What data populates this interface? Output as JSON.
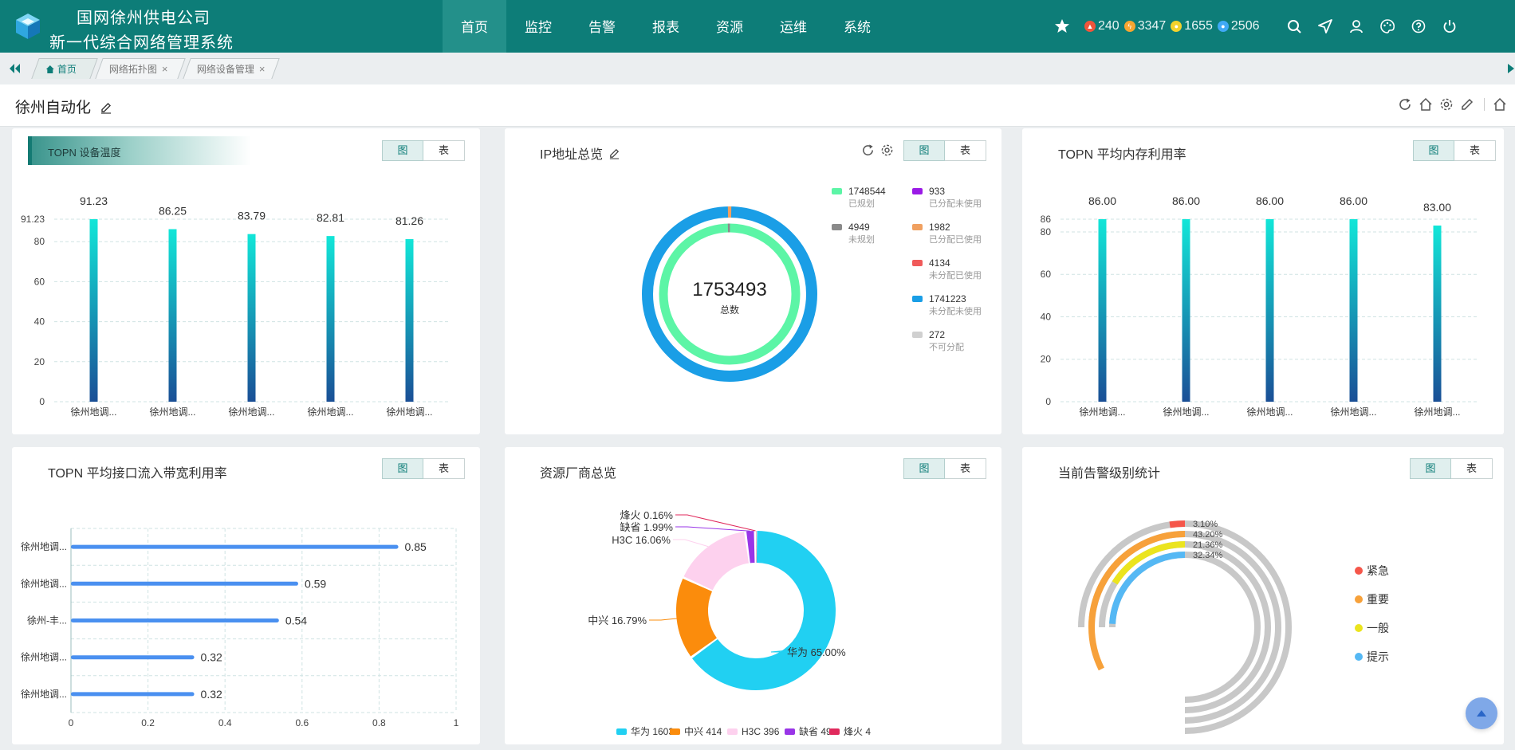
{
  "header": {
    "company": "国网徐州供电公司",
    "system": "新一代综合网络管理系统",
    "nav": [
      "首页",
      "监控",
      "告警",
      "报表",
      "资源",
      "运维",
      "系统"
    ],
    "stats": [
      {
        "icon": "fire-icon",
        "value": "240",
        "color": "#f0553b"
      },
      {
        "icon": "bolt-icon",
        "value": "3347",
        "color": "#f7a531"
      },
      {
        "icon": "sun-icon",
        "value": "1655",
        "color": "#f2d22c"
      },
      {
        "icon": "drop-icon",
        "value": "2506",
        "color": "#3fa9f5"
      }
    ]
  },
  "tabs": [
    {
      "label": "首页"
    },
    {
      "label": "网络拓扑图"
    },
    {
      "label": "网络设备管理"
    }
  ],
  "page": {
    "title": "徐州自动化"
  },
  "toggle": {
    "chart": "图",
    "table": "表"
  },
  "colors": {
    "brand": "#0d7d78",
    "accent": "#23908a"
  },
  "panels": {
    "temp": {
      "title": "TOPN 设备温度"
    },
    "ip": {
      "title": "IP地址总览"
    },
    "mem": {
      "title": "TOPN 平均内存利用率"
    },
    "bw": {
      "title": "TOPN 平均接口流入带宽利用率"
    },
    "vendor": {
      "title": "资源厂商总览"
    },
    "alarm": {
      "title": "当前告警级别统计"
    }
  },
  "chart_data": [
    {
      "id": "temp",
      "type": "bar",
      "categories": [
        "徐州地调...",
        "徐州地调...",
        "徐州地调...",
        "徐州地调...",
        "徐州地调..."
      ],
      "values": [
        91.23,
        86.25,
        83.79,
        82.81,
        81.26
      ],
      "labels": [
        "91.23",
        "86.25",
        "83.79",
        "82.81",
        "81.26"
      ],
      "yticks": [
        "0",
        "20",
        "40",
        "60",
        "80",
        "91.23"
      ],
      "ylim": [
        0,
        91.23
      ]
    },
    {
      "id": "ip",
      "type": "pie",
      "total": "1753493",
      "total_label": "总数",
      "legend": [
        {
          "value": "1748544",
          "name": "已规划",
          "color": "#5cf5a6"
        },
        {
          "value": "933",
          "name": "已分配未使用",
          "color": "#9a1ae6"
        },
        {
          "value": "4949",
          "name": "未规划",
          "color": "#8a8a8a"
        },
        {
          "value": "1982",
          "name": "已分配已使用",
          "color": "#f0a060"
        },
        {
          "value": "4134",
          "name": "未分配已使用",
          "color": "#f05a5a"
        },
        {
          "value": "1741223",
          "name": "未分配未使用",
          "color": "#1a9ee6"
        },
        {
          "value": "272",
          "name": "不可分配",
          "color": "#d0d0d0"
        }
      ]
    },
    {
      "id": "mem",
      "type": "bar",
      "categories": [
        "徐州地调...",
        "徐州地调...",
        "徐州地调...",
        "徐州地调...",
        "徐州地调..."
      ],
      "values": [
        86,
        86,
        86,
        86,
        83
      ],
      "labels": [
        "86.00",
        "86.00",
        "86.00",
        "86.00",
        "83.00"
      ],
      "yticks": [
        "0",
        "20",
        "40",
        "60",
        "80",
        "86"
      ],
      "ylim": [
        0,
        86
      ]
    },
    {
      "id": "bw",
      "type": "bar",
      "orientation": "horizontal",
      "categories": [
        "徐州地调...",
        "徐州地调...",
        "徐州-丰...",
        "徐州地调...",
        "徐州地调..."
      ],
      "values": [
        0.85,
        0.59,
        0.54,
        0.32,
        0.32
      ],
      "labels": [
        "0.85",
        "0.59",
        "0.54",
        "0.32",
        "0.32"
      ],
      "xticks": [
        "0",
        "0.2",
        "0.4",
        "0.6",
        "0.8",
        "1"
      ],
      "xlim": [
        0,
        1
      ]
    },
    {
      "id": "vendor",
      "type": "pie",
      "slices": [
        {
          "name": "华为",
          "value": 1603,
          "label": "华为 65.00%",
          "color": "#21d0f2"
        },
        {
          "name": "中兴",
          "value": 414,
          "label": "中兴 16.79%",
          "color": "#fb8c0c"
        },
        {
          "name": "H3C",
          "value": 396,
          "label": "H3C 16.06%",
          "color": "#fdd1ee"
        },
        {
          "name": "缺省",
          "value": 49,
          "label": "缺省 1.99%",
          "color": "#9935e7"
        },
        {
          "name": "烽火",
          "value": 4,
          "label": "烽火 0.16%",
          "color": "#e0295c"
        }
      ],
      "legend": [
        "华为 1603",
        "中兴 414",
        "H3C 396",
        "缺省 49",
        "烽火 4"
      ]
    },
    {
      "id": "alarm",
      "type": "pie",
      "series": [
        {
          "name": "紧急",
          "pct": 3.1,
          "label": "3.10%",
          "color": "#f5564a"
        },
        {
          "name": "重要",
          "pct": 43.2,
          "label": "43.20%",
          "color": "#f7a13a"
        },
        {
          "name": "一般",
          "pct": 21.36,
          "label": "21.36%",
          "color": "#ebe41e"
        },
        {
          "name": "提示",
          "pct": 32.34,
          "label": "32.34%",
          "color": "#55b8f4"
        }
      ]
    }
  ]
}
